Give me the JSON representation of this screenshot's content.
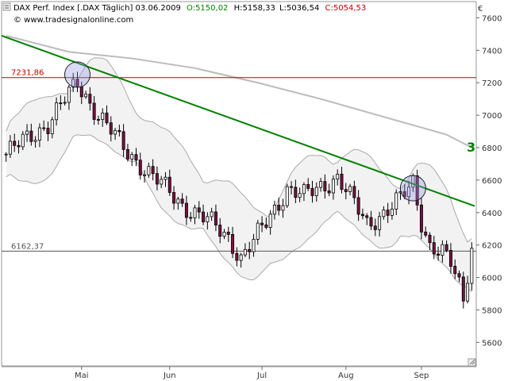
{
  "header": {
    "title": "DAX Perf. Index [.DAX  Täglich] 03.06.2009",
    "open": "O:5150,02",
    "high": "H:5158,33",
    "low": "L:5036,54",
    "close": "C:5054,53",
    "copyright": "© www.tradesignalonline.com",
    "open_color": "#008000",
    "close_color": "#c00000"
  },
  "chart_data": {
    "type": "candlestick",
    "currency_symbol": "€",
    "yticks": [
      5600,
      5800,
      6000,
      6200,
      6400,
      6600,
      6800,
      7000,
      7200,
      7400,
      7600
    ],
    "ytick_labels": [
      "5600",
      "5800",
      "6000",
      "6200",
      "6400",
      "6600",
      "6800",
      "7000",
      "7200",
      "7400",
      "7600"
    ],
    "ylim": [
      5450,
      7700
    ],
    "xlabels": [
      "Mai",
      "Jun",
      "Jul",
      "Aug",
      "Sep"
    ],
    "xlabel_positions": [
      18,
      39,
      61,
      81,
      99
    ],
    "x_count": 112,
    "levels": [
      {
        "label": "7231,86",
        "value": 7231.86,
        "color": "#c00000"
      },
      {
        "label": "6162,37",
        "value": 6162.37,
        "color": "#555555"
      }
    ],
    "trendline": {
      "x": [
        0,
        111
      ],
      "y": [
        7490,
        6440
      ],
      "color": "#008000"
    },
    "trendline_label": "3",
    "moving_average": {
      "x": [
        0,
        15,
        30,
        45,
        60,
        75,
        90,
        105,
        111
      ],
      "y": [
        7490,
        7390,
        7350,
        7290,
        7200,
        7100,
        6990,
        6880,
        6800
      ],
      "color": "#bbbbbb"
    },
    "circles": [
      {
        "x": 17,
        "y": 7250
      },
      {
        "x": 97,
        "y": 6550
      }
    ],
    "series": [
      {
        "name": "DAX",
        "ohlc": []
      }
    ]
  }
}
